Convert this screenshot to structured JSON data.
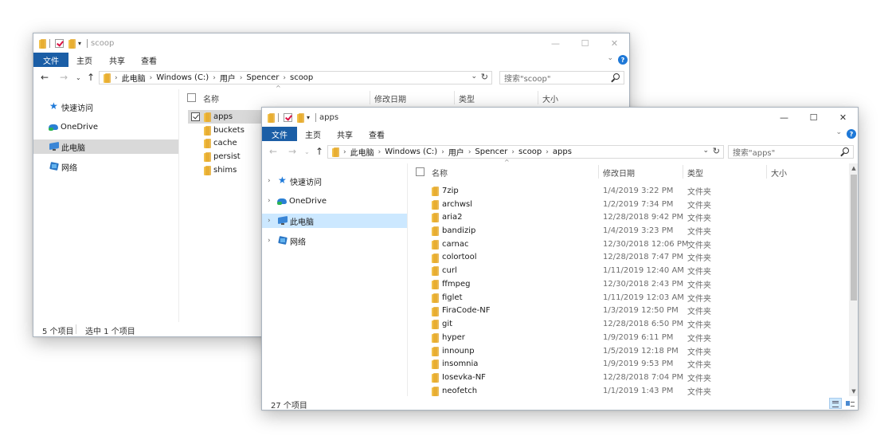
{
  "back_window": {
    "title": "scoop",
    "ribbon": {
      "file": "文件",
      "home": "主页",
      "share": "共享",
      "view": "查看"
    },
    "breadcrumb": [
      "此电脑",
      "Windows (C:)",
      "用户",
      "Spencer",
      "scoop"
    ],
    "search_placeholder": "搜索\"scoop\"",
    "columns": {
      "name": "名称",
      "date": "修改日期",
      "type": "类型",
      "size": "大小"
    },
    "nav": [
      "快速访问",
      "OneDrive",
      "此电脑",
      "网络"
    ],
    "items": [
      "apps",
      "buckets",
      "cache",
      "persist",
      "shims"
    ],
    "status": {
      "count": "5 个项目",
      "selected": "选中 1 个项目"
    }
  },
  "front_window": {
    "title": "apps",
    "ribbon": {
      "file": "文件",
      "home": "主页",
      "share": "共享",
      "view": "查看"
    },
    "breadcrumb": [
      "此电脑",
      "Windows (C:)",
      "用户",
      "Spencer",
      "scoop",
      "apps"
    ],
    "search_placeholder": "搜索\"apps\"",
    "columns": {
      "name": "名称",
      "date": "修改日期",
      "type": "类型",
      "size": "大小"
    },
    "nav": [
      "快速访问",
      "OneDrive",
      "此电脑",
      "网络"
    ],
    "files": [
      {
        "name": "7zip",
        "date": "1/4/2019 3:22 PM",
        "type": "文件夹"
      },
      {
        "name": "archwsl",
        "date": "1/2/2019 7:34 PM",
        "type": "文件夹"
      },
      {
        "name": "aria2",
        "date": "12/28/2018 9:42 PM",
        "type": "文件夹"
      },
      {
        "name": "bandizip",
        "date": "1/4/2019 3:23 PM",
        "type": "文件夹"
      },
      {
        "name": "carnac",
        "date": "12/30/2018 12:06 PM",
        "type": "文件夹"
      },
      {
        "name": "colortool",
        "date": "12/28/2018 7:47 PM",
        "type": "文件夹"
      },
      {
        "name": "curl",
        "date": "1/11/2019 12:40 AM",
        "type": "文件夹"
      },
      {
        "name": "ffmpeg",
        "date": "12/30/2018 2:43 PM",
        "type": "文件夹"
      },
      {
        "name": "figlet",
        "date": "1/11/2019 12:03 AM",
        "type": "文件夹"
      },
      {
        "name": "FiraCode-NF",
        "date": "1/3/2019 12:50 PM",
        "type": "文件夹"
      },
      {
        "name": "git",
        "date": "12/28/2018 6:50 PM",
        "type": "文件夹"
      },
      {
        "name": "hyper",
        "date": "1/9/2019 6:11 PM",
        "type": "文件夹"
      },
      {
        "name": "innounp",
        "date": "1/5/2019 12:18 PM",
        "type": "文件夹"
      },
      {
        "name": "insomnia",
        "date": "1/9/2019 9:53 PM",
        "type": "文件夹"
      },
      {
        "name": "Iosevka-NF",
        "date": "12/28/2018 7:04 PM",
        "type": "文件夹"
      },
      {
        "name": "neofetch",
        "date": "1/1/2019 1:43 PM",
        "type": "文件夹"
      }
    ],
    "status": {
      "count": "27 个项目"
    }
  },
  "colors": {
    "accent": "#1b5ea6",
    "selection": "#cce8ff",
    "folder": "#f2c14a"
  }
}
